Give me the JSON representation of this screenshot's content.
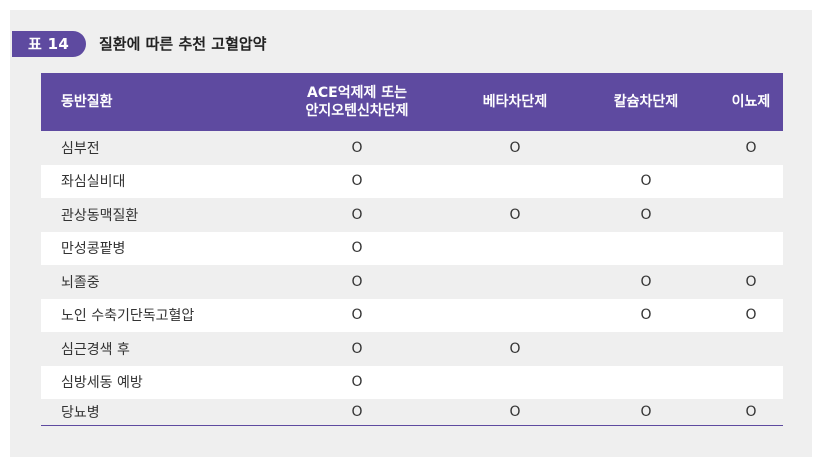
{
  "title": {
    "badge": "표 14",
    "caption": "질환에 따른 추천 고혈압약"
  },
  "table": {
    "headers": [
      "동반질환",
      "ACE억제제 또는\n안지오텐신차단제",
      "베타차단제",
      "칼슘차단제",
      "이뇨제"
    ],
    "rows": [
      [
        "심부전",
        "O",
        "O",
        "",
        "O"
      ],
      [
        "좌심실비대",
        "O",
        "",
        "O",
        ""
      ],
      [
        "관상동맥질환",
        "O",
        "O",
        "O",
        ""
      ],
      [
        "만성콩팥병",
        "O",
        "",
        "",
        ""
      ],
      [
        "뇌졸중",
        "O",
        "",
        "O",
        "O"
      ],
      [
        "노인 수축기단독고혈압",
        "O",
        "",
        "O",
        "O"
      ],
      [
        "심근경색 후",
        "O",
        "O",
        "",
        ""
      ],
      [
        "심방세동 예방",
        "O",
        "",
        "",
        ""
      ],
      [
        "당뇨병",
        "O",
        "O",
        "O",
        "O"
      ]
    ]
  },
  "colors": {
    "accent": "#5e4aa0",
    "panel": "#efefef"
  }
}
